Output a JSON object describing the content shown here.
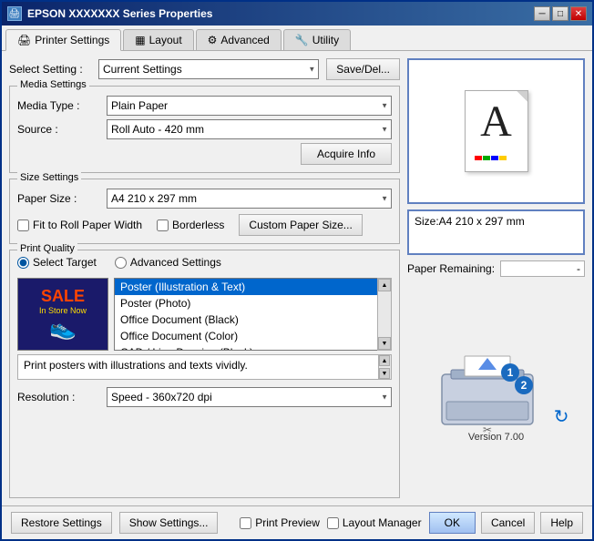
{
  "window": {
    "title": "EPSON XXXXXXX Series Properties",
    "close_btn": "✕",
    "min_btn": "─",
    "max_btn": "□"
  },
  "tabs": [
    {
      "id": "printer-settings",
      "label": "Printer Settings",
      "icon": "🖨",
      "active": true
    },
    {
      "id": "layout",
      "label": "Layout",
      "icon": "□",
      "active": false
    },
    {
      "id": "advanced",
      "label": "Advanced",
      "icon": "⚙",
      "active": false
    },
    {
      "id": "utility",
      "label": "Utility",
      "icon": "🔧",
      "active": false
    }
  ],
  "select_setting": {
    "label": "Select Setting :",
    "value": "Current Settings",
    "options": [
      "Current Settings"
    ],
    "save_button": "Save/Del..."
  },
  "media_settings": {
    "title": "Media Settings",
    "media_type_label": "Media Type :",
    "media_type_value": "Plain Paper",
    "source_label": "Source :",
    "source_value": "Roll Auto - 420 mm",
    "acquire_info_button": "Acquire Info"
  },
  "size_settings": {
    "title": "Size Settings",
    "paper_size_label": "Paper Size :",
    "paper_size_value": "A4 210 x 297 mm",
    "fit_to_roll": "Fit to Roll Paper Width",
    "borderless": "Borderless",
    "custom_paper_size_button": "Custom Paper Size..."
  },
  "print_quality": {
    "title": "Print Quality",
    "select_target_label": "Select Target",
    "advanced_settings_label": "Advanced Settings",
    "quality_items": [
      {
        "label": "Poster (Illustration & Text)",
        "selected": true
      },
      {
        "label": "Poster (Photo)",
        "selected": false
      },
      {
        "label": "Office Document (Black)",
        "selected": false
      },
      {
        "label": "Office Document (Color)",
        "selected": false
      },
      {
        "label": "CAD / Line Drawing (Black)",
        "selected": false
      }
    ],
    "description": "Print posters with illustrations and texts vividly.",
    "resolution_label": "Resolution :",
    "resolution_value": "Speed - 360x720 dpi"
  },
  "preview": {
    "size_label": "Size:A4 210 x 297 mm",
    "paper_remaining_label": "Paper Remaining:",
    "remaining_value": "-",
    "version_label": "Version 7.00"
  },
  "bottom_bar": {
    "restore_settings": "Restore Settings",
    "show_settings": "Show Settings...",
    "print_preview": "Print Preview",
    "layout_manager": "Layout Manager",
    "ok": "OK",
    "cancel": "Cancel",
    "help": "Help"
  }
}
